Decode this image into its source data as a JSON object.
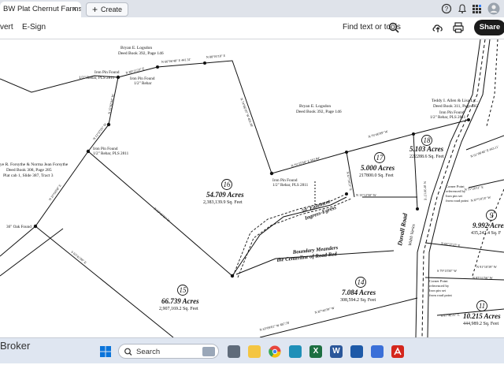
{
  "browser": {
    "tab_title": "BW Plat Chernut Farms ...",
    "tab_close": "×",
    "create_label": "Create"
  },
  "toolbar": {
    "convert_label": "vert",
    "esign_label": "E-Sign",
    "find_label": "Find text or tools",
    "share_label": "Share"
  },
  "plat": {
    "owners": [
      "Bryan E. Logsdon",
      "Deed Book 392, Page 146",
      "Bryan E. Logsdon",
      "Deed Book 392, Page 146",
      "ye R. Forsythe & Norma Jean Forsythe",
      "Deed Book 308, Page 285",
      "Plat cab 1, Slide 387, Tract 3",
      "Teddy I. Allen & Lisa Ly...",
      "Deed Book 311, Page 683"
    ],
    "pins": [
      "Iron Pin Found",
      "1/2\" Rebar, PLS 2811",
      "Iron Pin Found",
      "1/2\" Rebar",
      "Iron Pin Found",
      "1/2\" Rebar, PLS 2811",
      "Iron Pin Found",
      "1/2\" Rebar, PLS 2811",
      "36\" Oak Found",
      "Iron Pin Found",
      "1/2\" Rebar, PLS 2811"
    ],
    "easement": [
      "50' Easement",
      "Ingress-Egress"
    ],
    "meander": [
      "Boundary Meanders",
      "the Centerline of Road Bed"
    ],
    "road": [
      "Duvall Road",
      "Width Varies"
    ],
    "corner_notes": [
      "Corner Point",
      "referenced by",
      "Iron pin set",
      "from road point"
    ],
    "tracts": [
      {
        "num": "16",
        "acres": "54.709 Acres",
        "sqft": "2,383,139.9 Sq. Feet"
      },
      {
        "num": "15",
        "acres": "66.739 Acres",
        "sqft": "2,907,169.2 Sq. Feet"
      },
      {
        "num": "17",
        "acres": "5.000 Acres",
        "sqft": "217800.0 Sq. Feet"
      },
      {
        "num": "18",
        "acres": "5.103 Acres",
        "sqft": "222288.6 Sq. Feet"
      },
      {
        "num": "9",
        "acres": "9.992 Acres",
        "sqft": "435,242.4 Sq. F"
      },
      {
        "num": "14",
        "acres": "7.084 Acres",
        "sqft": "308,594.2 Sq. Feet"
      },
      {
        "num": "11",
        "acres": "10.215 Acres",
        "sqft": "444,989.2 Sq. Feet"
      }
    ],
    "bearings": [
      "N 80°11'23\" E",
      "N 66°06'48\" E  441.31'",
      "N 88°05'18\" E",
      "N 15°02'04\" W",
      "N 13°37'05\" W",
      "N 10°04'08\" E",
      "N 74°06'10\" W  403.38'",
      "N 53°46'15\" W",
      "S 63°41'08\" E",
      "N 76°25'58\" E  562.94'",
      "N 76°46'09\" W",
      "N 67°58'21\" E",
      "N 18°30'15\" E",
      "N 13°12'50\" W",
      "N 51°28'11\" E",
      "N 61°08'48\" E  443.11'",
      "N 68°37'27\" E",
      "S 79°13'50\" W",
      "N 87°44'39\" W",
      "N 63°09'02\" W  487.78'",
      "S 87°46'25\" E",
      "N 87°54'54\" W",
      "N 91°10'39\" W",
      "N 87°11'56\" W"
    ]
  },
  "taskbar": {
    "left_text": "Broker",
    "search_placeholder": "Search"
  },
  "colors": {
    "share_bg": "#1b1b1b",
    "tabbar_bg": "#dfe3ea",
    "taskbar_bg": "#dfe6f1",
    "excel": "#1d6f42",
    "word": "#2b579a",
    "acrobat": "#d4261c",
    "chrome": "#e8453c",
    "explorer": "#f4c542"
  },
  "icons": [
    "help-icon",
    "bell-icon",
    "apps-grid-icon",
    "avatar-icon",
    "search-icon",
    "upload-icon",
    "print-icon",
    "windows-icon",
    "chrome-icon",
    "excel-icon",
    "word-icon",
    "acrobat-icon"
  ]
}
